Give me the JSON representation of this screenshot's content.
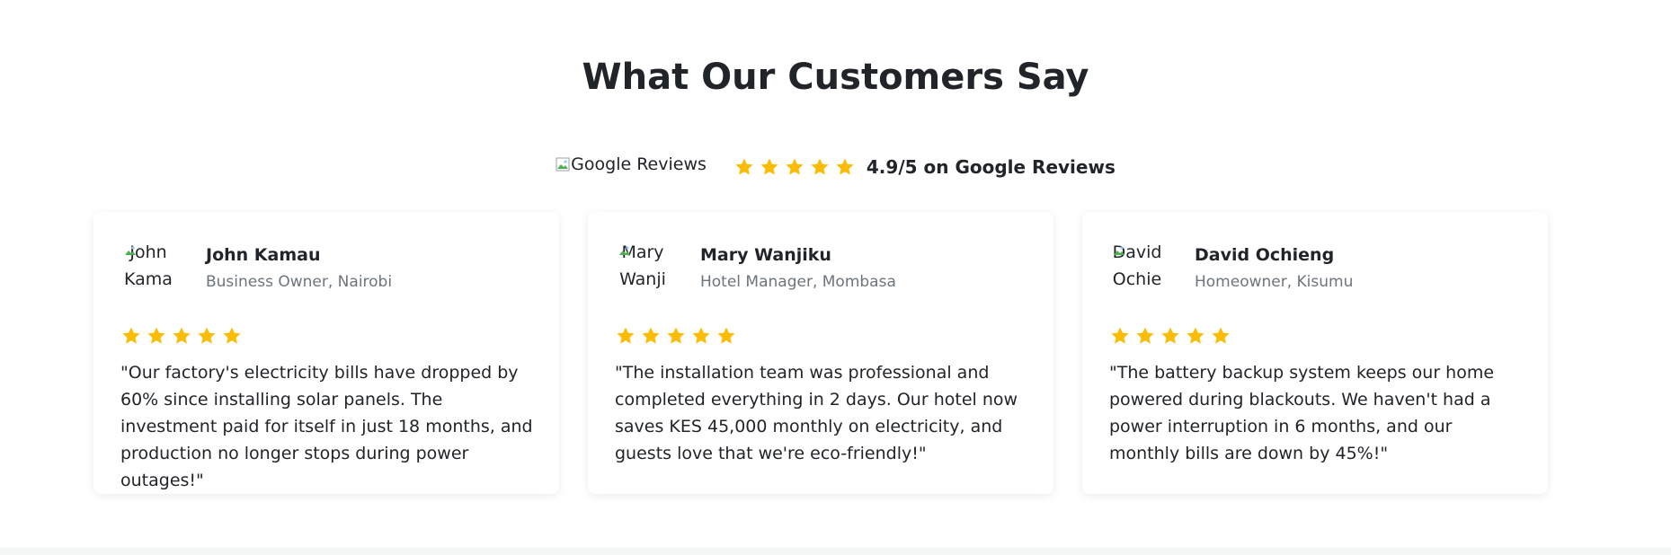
{
  "section": {
    "title": "What Our Customers Say"
  },
  "google": {
    "image_alt": "Google Reviews",
    "rating_text": "4.9/5 on Google Reviews",
    "stars": 5
  },
  "colors": {
    "star": "#fbbc05",
    "text": "#212529",
    "muted": "#6c757d"
  },
  "testimonials": [
    {
      "avatar_alt": "John Kamau",
      "name": "John Kamau",
      "role": "Business Owner, Nairobi",
      "stars": 5,
      "quote": "\"Our factory's electricity bills have dropped by 60% since installing solar panels. The investment paid for itself in just 18 months, and production no longer stops during power outages!\""
    },
    {
      "avatar_alt": "Mary Wanjiku",
      "name": "Mary Wanjiku",
      "role": "Hotel Manager, Mombasa",
      "stars": 5,
      "quote": "\"The installation team was professional and completed everything in 2 days. Our hotel now saves KES 45,000 monthly on electricity, and guests love that we're eco-friendly!\""
    },
    {
      "avatar_alt": "David Ochieng",
      "name": "David Ochieng",
      "role": "Homeowner, Kisumu",
      "stars": 5,
      "quote": "\"The battery backup system keeps our home powered during blackouts. We haven't had a power interruption in 6 months, and our monthly bills are down by 45%!\""
    }
  ]
}
